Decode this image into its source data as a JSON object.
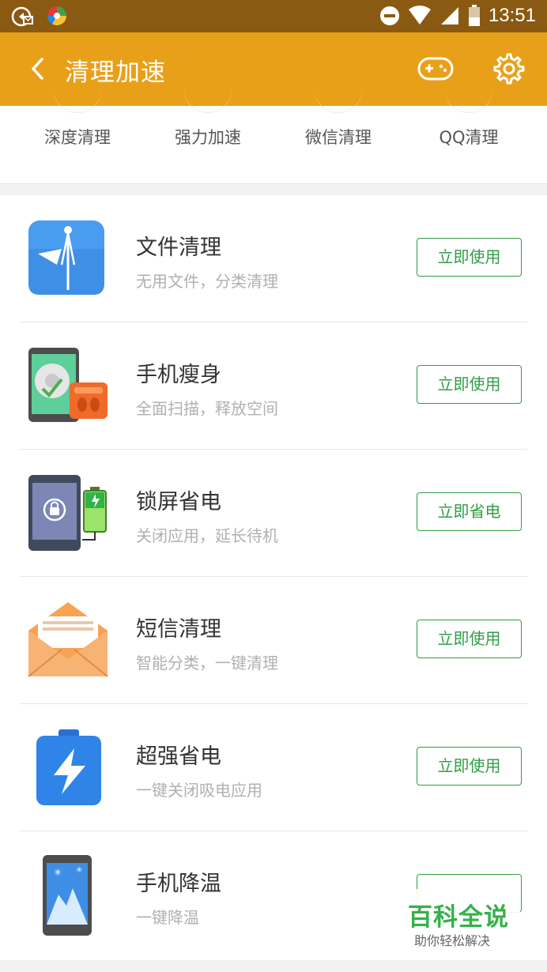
{
  "status_bar": {
    "time": "13:51",
    "icons": [
      "notification-icon",
      "color-wheel-icon",
      "do-not-disturb-icon",
      "wifi-icon",
      "signal-icon",
      "battery-icon"
    ]
  },
  "app_bar": {
    "title": "清理加速",
    "icons": [
      "back-icon",
      "gamepad-icon",
      "gear-icon"
    ],
    "background": "#e9a019"
  },
  "quick_actions": [
    {
      "label": "深度清理"
    },
    {
      "label": "强力加速"
    },
    {
      "label": "微信清理"
    },
    {
      "label": "QQ清理"
    }
  ],
  "tools": [
    {
      "name": "文件清理",
      "desc": "无用文件，分类清理",
      "button": "立即使用",
      "icon": "folder-icon"
    },
    {
      "name": "手机瘦身",
      "desc": "全面扫描，释放空间",
      "button": "立即使用",
      "icon": "phone-slim-icon"
    },
    {
      "name": "锁屏省电",
      "desc": "关闭应用，延长待机",
      "button": "立即省电",
      "icon": "lock-battery-icon"
    },
    {
      "name": "短信清理",
      "desc": "智能分类，一键清理",
      "button": "立即使用",
      "icon": "envelope-icon"
    },
    {
      "name": "超强省电",
      "desc": "一键关闭吸电应用",
      "button": "立即使用",
      "icon": "battery-bolt-icon"
    },
    {
      "name": "手机降温",
      "desc": "一键降温",
      "button": "",
      "icon": "phone-cool-icon"
    }
  ],
  "watermark": {
    "title": "百科全说",
    "subtitle": "助你轻松解决"
  },
  "colors": {
    "accent_green": "#2f9e44",
    "status_bar": "#8a5a12"
  }
}
